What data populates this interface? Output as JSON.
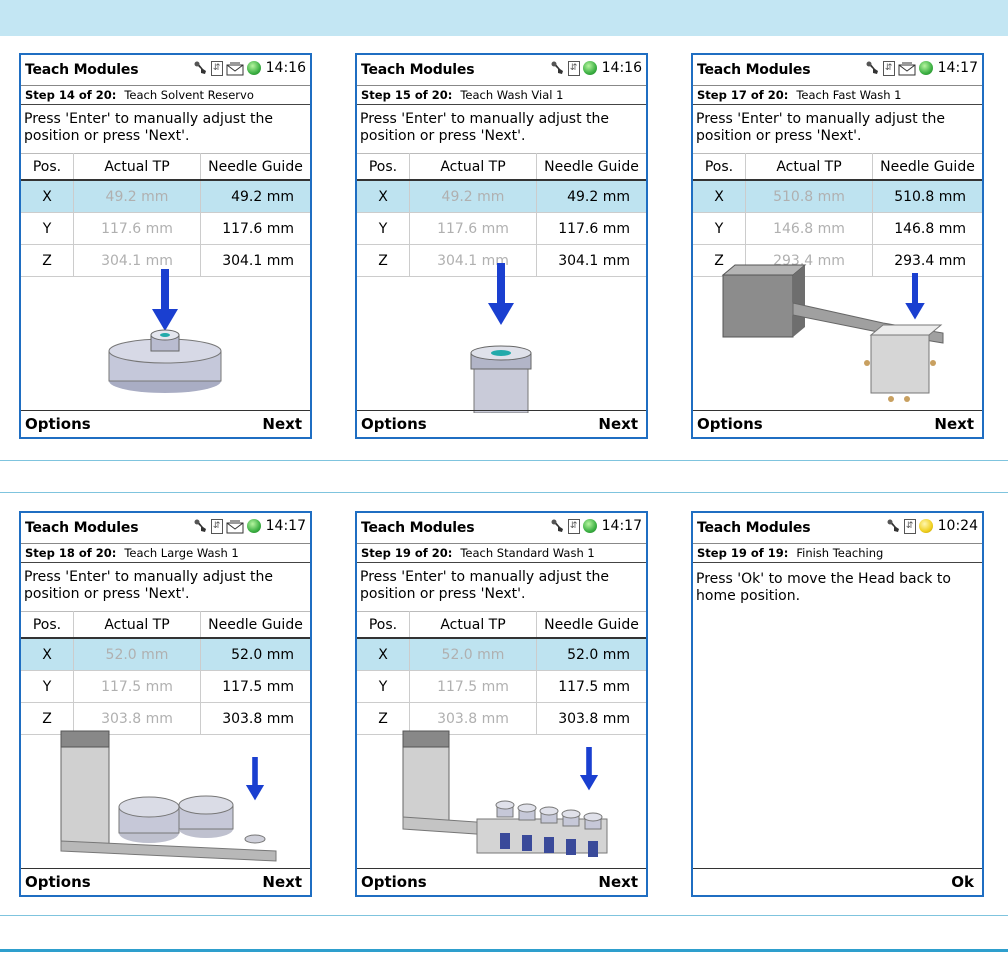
{
  "screens": [
    {
      "title": "Teach Modules",
      "time": "14:16",
      "status_icons": [
        "wrench-icon",
        "usb-icon",
        "mail-icon",
        "led-green-icon"
      ],
      "step": "Step 14 of 20:",
      "step_name": "Teach Solvent Reservo",
      "message": "Press 'Enter' to manually adjust the position or press 'Next'.",
      "columns": [
        "Pos.",
        "Actual TP",
        "Needle Guide"
      ],
      "rows": [
        {
          "pos": "X",
          "actual": "49.2 mm",
          "guide": "49.2 mm"
        },
        {
          "pos": "Y",
          "actual": "117.6 mm",
          "guide": "117.6 mm"
        },
        {
          "pos": "Z",
          "actual": "304.1 mm",
          "guide": "304.1 mm"
        }
      ],
      "left_button": "Options",
      "right_button": "Next",
      "illustration": "solvent-reservoir"
    },
    {
      "title": "Teach Modules",
      "time": "14:16",
      "status_icons": [
        "wrench-icon",
        "usb-icon",
        "led-green-icon"
      ],
      "step": "Step 15 of 20:",
      "step_name": "Teach Wash Vial 1",
      "message": "Press 'Enter' to manually adjust the position or press 'Next'.",
      "columns": [
        "Pos.",
        "Actual TP",
        "Needle Guide"
      ],
      "rows": [
        {
          "pos": "X",
          "actual": "49.2 mm",
          "guide": "49.2 mm"
        },
        {
          "pos": "Y",
          "actual": "117.6 mm",
          "guide": "117.6 mm"
        },
        {
          "pos": "Z",
          "actual": "304.1 mm",
          "guide": "304.1 mm"
        }
      ],
      "left_button": "Options",
      "right_button": "Next",
      "illustration": "wash-vial"
    },
    {
      "title": "Teach Modules",
      "time": "14:17",
      "status_icons": [
        "wrench-icon",
        "usb-icon",
        "mail-icon",
        "led-green-icon"
      ],
      "step": "Step 17 of 20:",
      "step_name": "Teach Fast Wash 1",
      "message": "Press 'Enter' to manually adjust the position or press 'Next'.",
      "columns": [
        "Pos.",
        "Actual TP",
        "Needle Guide"
      ],
      "rows": [
        {
          "pos": "X",
          "actual": "510.8 mm",
          "guide": "510.8 mm"
        },
        {
          "pos": "Y",
          "actual": "146.8 mm",
          "guide": "146.8 mm"
        },
        {
          "pos": "Z",
          "actual": "293.4 mm",
          "guide": "293.4 mm"
        }
      ],
      "left_button": "Options",
      "right_button": "Next",
      "illustration": "fast-wash"
    },
    {
      "title": "Teach Modules",
      "time": "14:17",
      "status_icons": [
        "wrench-icon",
        "usb-icon",
        "mail-icon",
        "led-green-icon"
      ],
      "step": "Step 18 of 20:",
      "step_name": "Teach Large Wash 1",
      "message": "Press 'Enter' to manually adjust the position or press 'Next'.",
      "columns": [
        "Pos.",
        "Actual TP",
        "Needle Guide"
      ],
      "rows": [
        {
          "pos": "X",
          "actual": "52.0 mm",
          "guide": "52.0 mm"
        },
        {
          "pos": "Y",
          "actual": "117.5 mm",
          "guide": "117.5 mm"
        },
        {
          "pos": "Z",
          "actual": "303.8 mm",
          "guide": "303.8 mm"
        }
      ],
      "left_button": "Options",
      "right_button": "Next",
      "illustration": "large-wash"
    },
    {
      "title": "Teach Modules",
      "time": "14:17",
      "status_icons": [
        "wrench-icon",
        "usb-icon",
        "led-green-icon"
      ],
      "step": "Step 19 of 20:",
      "step_name": "Teach Standard Wash 1",
      "message": "Press 'Enter' to manually adjust the position or press 'Next'.",
      "columns": [
        "Pos.",
        "Actual TP",
        "Needle Guide"
      ],
      "rows": [
        {
          "pos": "X",
          "actual": "52.0 mm",
          "guide": "52.0 mm"
        },
        {
          "pos": "Y",
          "actual": "117.5 mm",
          "guide": "117.5 mm"
        },
        {
          "pos": "Z",
          "actual": "303.8 mm",
          "guide": "303.8 mm"
        }
      ],
      "left_button": "Options",
      "right_button": "Next",
      "illustration": "standard-wash"
    },
    {
      "title": "Teach Modules",
      "time": "10:24",
      "status_icons": [
        "wrench-icon",
        "usb-icon",
        "led-yellow-icon"
      ],
      "step": "Step 19 of 19:",
      "step_name": "Finish Teaching",
      "message": "Press 'Ok' to move the Head back to home position.",
      "right_button": "Ok"
    }
  ],
  "colors": {
    "top_band": "#c3e6f3",
    "screen_border": "#1f6ec2",
    "selected_row": "#bee3f0",
    "arrow_blue": "#1a3fd0",
    "led_green": "#3cb043",
    "led_yellow": "#f0d020"
  }
}
